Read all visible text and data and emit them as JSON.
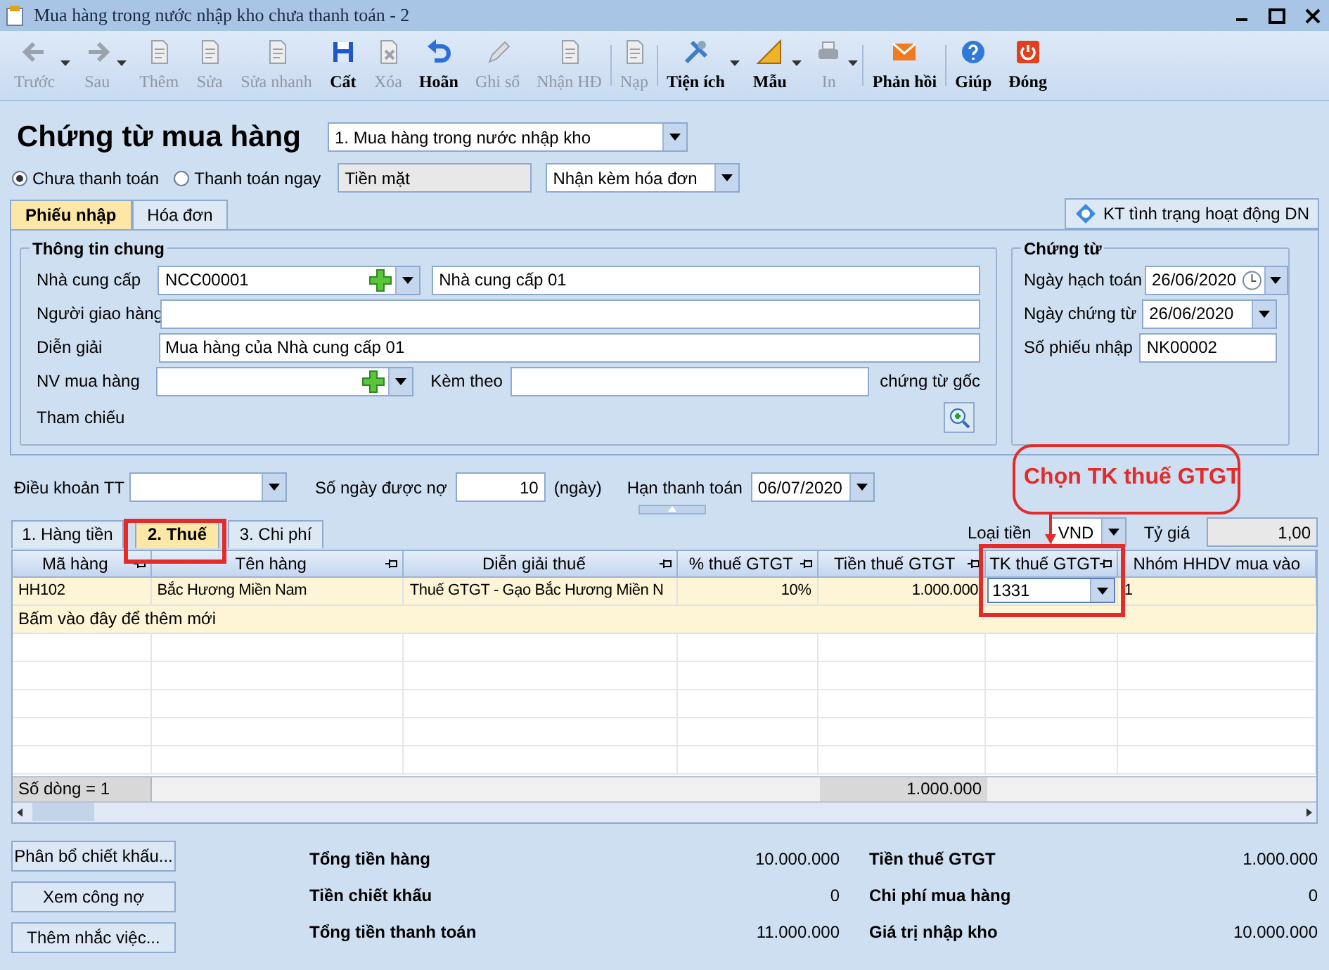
{
  "window": {
    "title": "Mua hàng trong nước nhập kho chưa thanh toán - 2"
  },
  "toolbar": [
    {
      "label": "Trước",
      "enabled": false,
      "dropdown": true
    },
    {
      "label": "Sau",
      "enabled": false,
      "dropdown": true
    },
    {
      "label": "Thêm",
      "enabled": false,
      "dropdown": false
    },
    {
      "label": "Sửa",
      "enabled": false,
      "dropdown": false
    },
    {
      "label": "Sửa nhanh",
      "enabled": false,
      "dropdown": false
    },
    {
      "label": "Cất",
      "enabled": true,
      "dropdown": false
    },
    {
      "label": "Xóa",
      "enabled": false,
      "dropdown": false
    },
    {
      "label": "Hoãn",
      "enabled": true,
      "dropdown": false
    },
    {
      "label": "Ghi sổ",
      "enabled": false,
      "dropdown": false
    },
    {
      "label": "Nhận HĐ",
      "enabled": false,
      "dropdown": false
    },
    {
      "label": "Nạp",
      "enabled": false,
      "dropdown": false
    },
    {
      "label": "Tiện ích",
      "enabled": true,
      "dropdown": true
    },
    {
      "label": "Mẫu",
      "enabled": true,
      "dropdown": true
    },
    {
      "label": "In",
      "enabled": false,
      "dropdown": true
    },
    {
      "label": "Phản hồi",
      "enabled": true,
      "dropdown": false
    },
    {
      "label": "Giúp",
      "enabled": true,
      "dropdown": false
    },
    {
      "label": "Đóng",
      "enabled": true,
      "dropdown": false
    }
  ],
  "header": {
    "title": "Chứng từ mua hàng",
    "voucher_type": "1. Mua hàng trong nước nhập kho",
    "payment_options": [
      {
        "label": "Chưa thanh toán",
        "selected": true
      },
      {
        "label": "Thanh toán ngay",
        "selected": false
      }
    ],
    "payment_method": "Tiền mặt",
    "invoice_option": "Nhận kèm hóa đơn"
  },
  "tabs": [
    {
      "label": "Phiếu nhập",
      "selected": true
    },
    {
      "label": "Hóa đơn",
      "selected": false
    }
  ],
  "check_button": "KT tình trạng hoạt động DN",
  "general_info": {
    "title": "Thông tin chung",
    "supplier_label": "Nhà cung cấp",
    "supplier_code": "NCC00001",
    "supplier_name": "Nhà cung cấp 01",
    "deliverer_label": "Người giao hàng",
    "description_label": "Diễn giải",
    "description": "Mua hàng của Nhà cung cấp 01",
    "buyer_label": "NV mua hàng",
    "attached_label": "Kèm theo",
    "attached_suffix": "chứng từ gốc",
    "reference_label": "Tham chiếu"
  },
  "voucher": {
    "title": "Chứng từ",
    "fields": [
      {
        "label": "Ngày hạch toán",
        "value": "26/06/2020",
        "kind": "datetime"
      },
      {
        "label": "Ngày chứng từ",
        "value": "26/06/2020",
        "kind": "date"
      },
      {
        "label": "Số phiếu nhập",
        "value": "NK00002",
        "kind": "text"
      }
    ]
  },
  "terms": {
    "terms_label": "Điều khoản TT",
    "days_label": "Số ngày được nợ",
    "days": "10",
    "days_unit": "(ngày)",
    "due_label": "Hạn thanh toán",
    "due_date": "06/07/2020"
  },
  "detail_tabs": [
    {
      "label": "1. Hàng tiền",
      "selected": false
    },
    {
      "label": "2. Thuế",
      "selected": true
    },
    {
      "label": "3. Chi phí",
      "selected": false
    }
  ],
  "currency": {
    "label": "Loại tiền",
    "value": "VND",
    "rate_label": "Tỷ giá",
    "rate": "1,00"
  },
  "grid": {
    "columns": [
      {
        "label": "Mã hàng"
      },
      {
        "label": "Tên hàng"
      },
      {
        "label": "Diễn giải thuế"
      },
      {
        "label": "% thuế GTGT"
      },
      {
        "label": "Tiền thuế GTGT"
      },
      {
        "label": "TK thuế GTGT"
      },
      {
        "label": "Nhóm HHDV mua vào"
      }
    ],
    "rows": [
      {
        "selected": true,
        "cells": [
          {
            "text": "HH102",
            "editing": false
          },
          {
            "text": "Bắc Hương Miền Nam",
            "editing": false
          },
          {
            "text": "Thuế GTGT - Gạo Bắc Hương Miền N",
            "editing": false
          },
          {
            "text": "10%",
            "editing": false
          },
          {
            "text": "1.000.000",
            "editing": false
          },
          {
            "text": "1331",
            "editing": true
          },
          {
            "text": "1",
            "editing": false
          }
        ]
      }
    ],
    "new_row_hint": "Bấm vào đây để thêm mới",
    "row_count": "Số dòng = 1",
    "tax_total": "1.000.000"
  },
  "buttons": [
    "Phân bổ chiết khấu...",
    "Xem công nợ",
    "Thêm nhắc việc..."
  ],
  "totals_left": [
    {
      "label": "Tổng tiền hàng",
      "value": "10.000.000"
    },
    {
      "label": "Tiền chiết khấu",
      "value": "0"
    },
    {
      "label": "Tổng tiền thanh toán",
      "value": "11.000.000"
    }
  ],
  "totals_right": [
    {
      "label": "Tiền thuế GTGT",
      "value": "1.000.000"
    },
    {
      "label": "Chi phí mua hàng",
      "value": "0"
    },
    {
      "label": "Giá trị nhập kho",
      "value": "10.000.000"
    }
  ],
  "annotation": {
    "text": "Chọn TK thuế GTGT"
  }
}
